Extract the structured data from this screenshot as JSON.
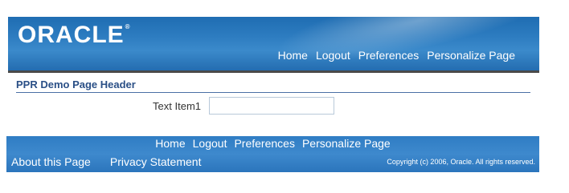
{
  "header": {
    "logo": "ORACLE",
    "logo_mark": "®",
    "links": [
      "Home",
      "Logout",
      "Preferences",
      "Personalize Page"
    ]
  },
  "page": {
    "title": "PPR Demo Page Header",
    "text_item_label": "Text Item1",
    "text_item_value": ""
  },
  "footer": {
    "links": [
      "Home",
      "Logout",
      "Preferences",
      "Personalize Page"
    ],
    "about": "About this Page",
    "privacy": "Privacy Statement",
    "copyright": "Copyright (c) 2006, Oracle. All rights reserved."
  },
  "colors": {
    "brand_blue": "#2d7cc0",
    "title_blue": "#2a4f86"
  }
}
